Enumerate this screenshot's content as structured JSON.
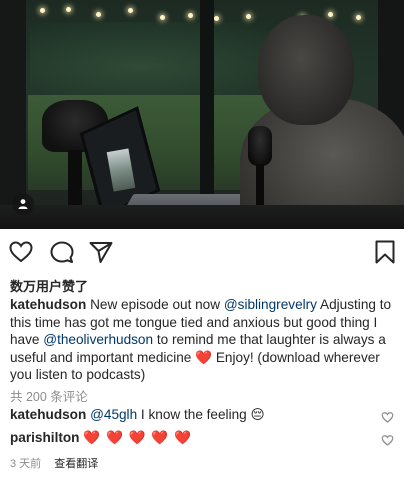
{
  "post": {
    "likes_text": "数万用户赞了",
    "caption": {
      "username": "katehudson",
      "text_1": "New episode out now",
      "mention_1": "@siblingrevelry",
      "text_2": "Adjusting to this time has got me tongue tied and anxious but good thing I have",
      "mention_2": "@theoliverhudson",
      "text_3": "to remind me that laughter is always a useful and important medicine",
      "heart": "❤️",
      "text_4": "Enjoy! (download wherever you listen to podcasts)"
    },
    "view_comments": "共 200 条评论",
    "comments": [
      {
        "username": "katehudson",
        "mention": "@45glh",
        "text": "I know the feeling",
        "emoji": "😔"
      },
      {
        "username": "parishilton",
        "text": "❤️ ❤️ ❤️ ❤️ ❤️"
      }
    ],
    "timestamp": "3 天前",
    "translate": "查看翻译"
  },
  "icons": {
    "like": "heart-outline-icon",
    "comment": "comment-bubble-icon",
    "share": "paper-plane-icon",
    "save": "bookmark-icon",
    "tag": "person-tag-icon"
  },
  "colors": {
    "text": "#262626",
    "mention": "#00376b",
    "secondary": "#8e8e8e",
    "heart": "#ed4956"
  }
}
